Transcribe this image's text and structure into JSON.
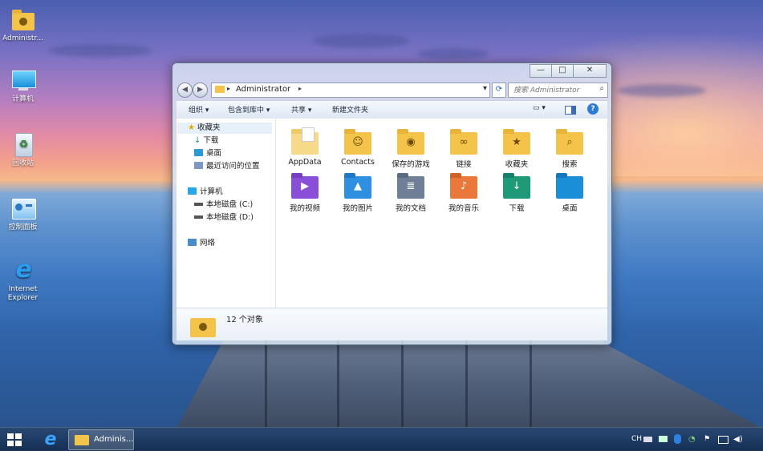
{
  "desktop": {
    "icons": [
      {
        "label": "Administr...",
        "icon": "user-folder-icon"
      },
      {
        "label": "计算机",
        "icon": "computer-icon"
      },
      {
        "label": "回收站",
        "icon": "recycle-bin-icon"
      },
      {
        "label": "控制面板",
        "icon": "control-panel-icon"
      },
      {
        "label": "Internet Explorer",
        "icon": "internet-explorer-icon"
      }
    ]
  },
  "window": {
    "controls": {
      "minimize": "—",
      "maximize": "□",
      "close": "✕"
    },
    "address": {
      "path": "Administrator",
      "sep": "▸",
      "dropdown": "▾"
    },
    "search": {
      "placeholder": "搜索 Administrator",
      "icon": "⌕"
    },
    "toolbar": {
      "organize": "组织 ▾",
      "include_in_library": "包含到库中 ▾",
      "share": "共享 ▾",
      "new_folder": "新建文件夹",
      "view_glyph": "▭ ▾",
      "help_glyph": "?"
    },
    "nav": {
      "favorites": "收藏夹",
      "downloads": "下载",
      "desktop": "桌面",
      "recent": "最近访问的位置",
      "computer": "计算机",
      "drive_c": "本地磁盘 (C:)",
      "drive_d": "本地磁盘 (D:)",
      "network": "网络"
    },
    "items": [
      {
        "label": "AppData",
        "icon": "appdata-folder-icon",
        "glyph": ""
      },
      {
        "label": "Contacts",
        "icon": "contacts-folder-icon",
        "glyph": "☺"
      },
      {
        "label": "保存的游戏",
        "icon": "saved-games-folder-icon",
        "glyph": "◉"
      },
      {
        "label": "链接",
        "icon": "links-folder-icon",
        "glyph": "∞"
      },
      {
        "label": "收藏夹",
        "icon": "favorites-folder-icon",
        "glyph": "★"
      },
      {
        "label": "搜索",
        "icon": "searches-folder-icon",
        "glyph": "⌕"
      },
      {
        "label": "我的视频",
        "icon": "videos-folder-icon",
        "glyph": "▶"
      },
      {
        "label": "我的图片",
        "icon": "pictures-folder-icon",
        "glyph": "▲"
      },
      {
        "label": "我的文档",
        "icon": "documents-folder-icon",
        "glyph": "≣"
      },
      {
        "label": "我的音乐",
        "icon": "music-folder-icon",
        "glyph": "♪"
      },
      {
        "label": "下载",
        "icon": "downloads-folder-icon",
        "glyph": "↓"
      },
      {
        "label": "桌面",
        "icon": "desktop-folder-icon",
        "glyph": ""
      }
    ],
    "status": "12 个对象"
  },
  "taskbar": {
    "task_label": "Adminis...",
    "tray": {
      "lang": "CH"
    }
  }
}
